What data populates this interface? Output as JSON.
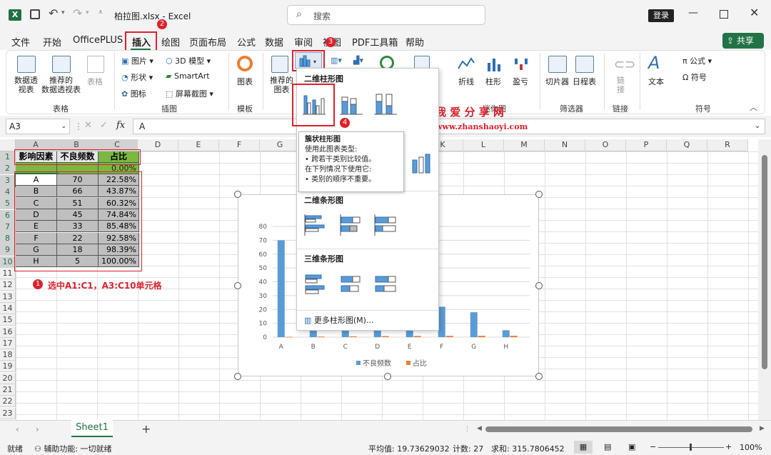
{
  "title": {
    "file": "柏拉图.xlsx",
    "sep": " - ",
    "app": "Excel",
    "search": "搜索",
    "login": "登录",
    "share": "共享"
  },
  "tabs": [
    "文件",
    "开始",
    "OfficePLUS",
    "插入",
    "绘图",
    "页面布局",
    "公式",
    "数据",
    "审阅",
    "视图",
    "PDF工具箱",
    "帮助"
  ],
  "ribbon": {
    "pivot": "数据透\n视表",
    "rec_pivot": "推荐的\n数据透视表",
    "table": "表格",
    "grp_table": "表格",
    "picture": "图片",
    "shape": "形状",
    "icon": "图标",
    "model3d": "3D 模型",
    "smartart": "SmartArt",
    "screenshot": "屏幕截图",
    "grp_illus": "插图",
    "chart": "图表",
    "grp_module": "模板",
    "rec_chart": "推荐的\n图表",
    "line": "折线",
    "column": "柱形",
    "winloss": "盈亏",
    "grp_spark": "迷你图",
    "slicer": "切片器",
    "timeline": "日程表",
    "grp_filter": "筛选器",
    "link": "链\n接",
    "grp_link": "链接",
    "text": "文本",
    "formula": "公式",
    "symbol": "符号",
    "grp_symbol": "符号"
  },
  "formula_bar": {
    "namebox": "A3",
    "fx": "fx",
    "content": "A"
  },
  "columns": [
    "A",
    "B",
    "C",
    "D",
    "E",
    "F",
    "G",
    "H",
    "I",
    "J",
    "K",
    "L",
    "M",
    "N",
    "O",
    "P",
    "Q",
    "R"
  ],
  "rows": [
    "1",
    "2",
    "3",
    "4",
    "5",
    "6",
    "7",
    "8",
    "9",
    "10",
    "11",
    "12",
    "13",
    "14",
    "15",
    "16",
    "17",
    "18",
    "19",
    "20",
    "21",
    "22",
    "23"
  ],
  "table": {
    "header": [
      "影响因素",
      "不良频数",
      "占比"
    ],
    "row2_pct": "0.00%",
    "data": [
      [
        "A",
        "70",
        "22.58%"
      ],
      [
        "B",
        "66",
        "43.87%"
      ],
      [
        "C",
        "51",
        "60.32%"
      ],
      [
        "D",
        "45",
        "74.84%"
      ],
      [
        "E",
        "33",
        "85.48%"
      ],
      [
        "F",
        "22",
        "92.58%"
      ],
      [
        "G",
        "18",
        "98.39%"
      ],
      [
        "H",
        "5",
        "100.00%"
      ]
    ]
  },
  "annotation": {
    "step1": "选中A1:C1，A3:C10单元格",
    "n1": "1",
    "n2": "2",
    "n3": "3",
    "n4": "4"
  },
  "watermark": {
    "cn": "我 爱 分 享 网",
    "url": "www.zhanshaoyi.com"
  },
  "dropdown": {
    "sec2d": "二维柱形图",
    "sec3d": "三维柱形图",
    "sec2dbar": "二维条形图",
    "sec3dbar": "三维条形图",
    "more": "更多柱形图(M)...",
    "tip_title": "簇状柱形图",
    "tip_l1": "使用此图表类型:",
    "tip_l2": "• 跨若干类别比较值。",
    "tip_l3": "在下列情况下使用它:",
    "tip_l4": "• 类别的顺序不重要。"
  },
  "chart_data": {
    "type": "bar",
    "categories": [
      "A",
      "B",
      "C",
      "D",
      "E",
      "F",
      "G",
      "H"
    ],
    "series": [
      {
        "name": "不良频数",
        "values": [
          70,
          66,
          51,
          45,
          33,
          22,
          18,
          5
        ],
        "color": "#5b9bd5"
      },
      {
        "name": "占比",
        "values": [
          0.23,
          0.44,
          0.6,
          0.75,
          0.85,
          0.93,
          0.98,
          1.0
        ],
        "color": "#ed7d31"
      }
    ],
    "yticks": [
      "0",
      "10",
      "20",
      "30",
      "40",
      "50",
      "60",
      "70",
      "80"
    ],
    "ylim": [
      0,
      80
    ],
    "grid": true,
    "legend": "bottom"
  },
  "sheet": {
    "tab": "Sheet1",
    "add": "+"
  },
  "status": {
    "ready": "就绪",
    "access": "辅助功能: 一切就绪",
    "avg": "平均值: 19.73629032",
    "count": "计数: 27",
    "sum": "求和: 315.7806452",
    "zoom": "100%"
  },
  "colors": {
    "accent": "#217346",
    "red": "#e0202a",
    "excel_green": "#1e7145"
  }
}
